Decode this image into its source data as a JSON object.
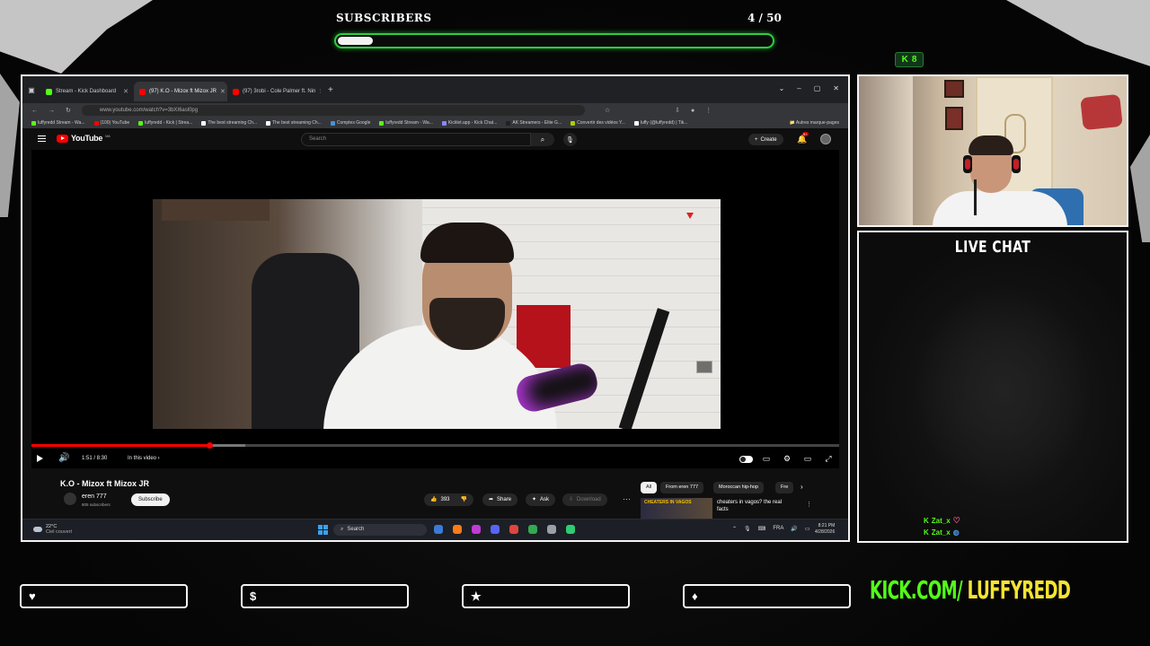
{
  "overlay": {
    "subscribers_label": "SUBSCRIBERS",
    "subscribers_count": "4 / 50",
    "subscribers_progress": 0.08,
    "viewer_count": "8",
    "live_chat_title": "LIVE CHAT",
    "brand_kick": "KICK.COM/",
    "brand_name": "LUFFYREDD",
    "social_icons": [
      "heart-icon",
      "dollar-icon",
      "star-icon",
      "drop-icon"
    ],
    "social_glyphs": [
      "♥",
      "$",
      "★",
      "♦"
    ],
    "accent_green": "#53fc18",
    "accent_yellow": "#f5e431",
    "progress_border": "#2ecc40"
  },
  "browser": {
    "tabs": [
      {
        "label": "Stream - Kick Dashboard",
        "favicon_color": "#53fc18",
        "active": false
      },
      {
        "label": "(97) K.O - Mizox ft Mizox JR",
        "favicon_color": "#ff0000",
        "active": true
      },
      {
        "label": "(97) 3robi - Cole Palmer ft. Nin",
        "favicon_color": "#ff0000",
        "active": false
      }
    ],
    "new_tab": "+",
    "url": "www.youtube.com/watch?v=3bXI6asl0pg",
    "bookmarks": [
      {
        "label": "luffyredd Stream - Wa...",
        "color": "#53fc18"
      },
      {
        "label": "(100) YouTube",
        "color": "#ff0000"
      },
      {
        "label": "luffyredd - Kick | Strea...",
        "color": "#53fc18"
      },
      {
        "label": "The best streaming Ch...",
        "color": "#ffffff"
      },
      {
        "label": "The best streaming Ch...",
        "color": "#ffffff"
      },
      {
        "label": "Comptes Google",
        "color": "#4a90d9"
      },
      {
        "label": "luffyredd Stream - Wa...",
        "color": "#53fc18"
      },
      {
        "label": "Kicklet.app - Kick Chat...",
        "color": "#8888ff"
      },
      {
        "label": "AK Streamers - Elite G...",
        "color": "#222222"
      },
      {
        "label": "Convertir des vidéos Y...",
        "color": "#a8d000"
      },
      {
        "label": "luffy (@luffyredd) | Tik...",
        "color": "#ffffff"
      }
    ],
    "bookmarks_other": "Autres marque-pages"
  },
  "youtube": {
    "logo_text": "YouTube",
    "logo_region": "MA",
    "search_placeholder": "Search",
    "create_label": "Create",
    "notif_count": "9+",
    "time_display": "1:51 / 8:30",
    "chapter_label": "In this video ›",
    "progress_played": 0.22,
    "progress_buffered": 0.265,
    "video_title": "K.O - Mizox ft Mizox JR",
    "channel_name": "eren 777",
    "channel_subs": "805 subscribers",
    "subscribe_label": "Subscribe",
    "like_count": "393",
    "share_label": "Share",
    "ask_label": "Ask",
    "download_label": "Download",
    "chips": [
      "All",
      "From eren 777",
      "Moroccan hip-hop",
      "Fre"
    ],
    "reco_title": "cheaters in vagos? the real facts",
    "reco_thumb_text": "CHEATERS IN VAGOS"
  },
  "taskbar": {
    "temp": "22°C",
    "weather": "Ciel couvert",
    "search": "Search",
    "lang": "FRA",
    "time": "8:21 PM",
    "date": "4/28/2026",
    "apps": [
      "#3a7bd5",
      "#ff7a18",
      "#c23bd4",
      "#5865f2",
      "#e0443e",
      "#34a853",
      "#9aa0a6",
      "#2ecc71"
    ]
  },
  "chat": {
    "messages": [
      {
        "user": "Zat_x",
        "badge": "heart"
      },
      {
        "user": "Zat_x",
        "badge": "globe"
      }
    ]
  }
}
